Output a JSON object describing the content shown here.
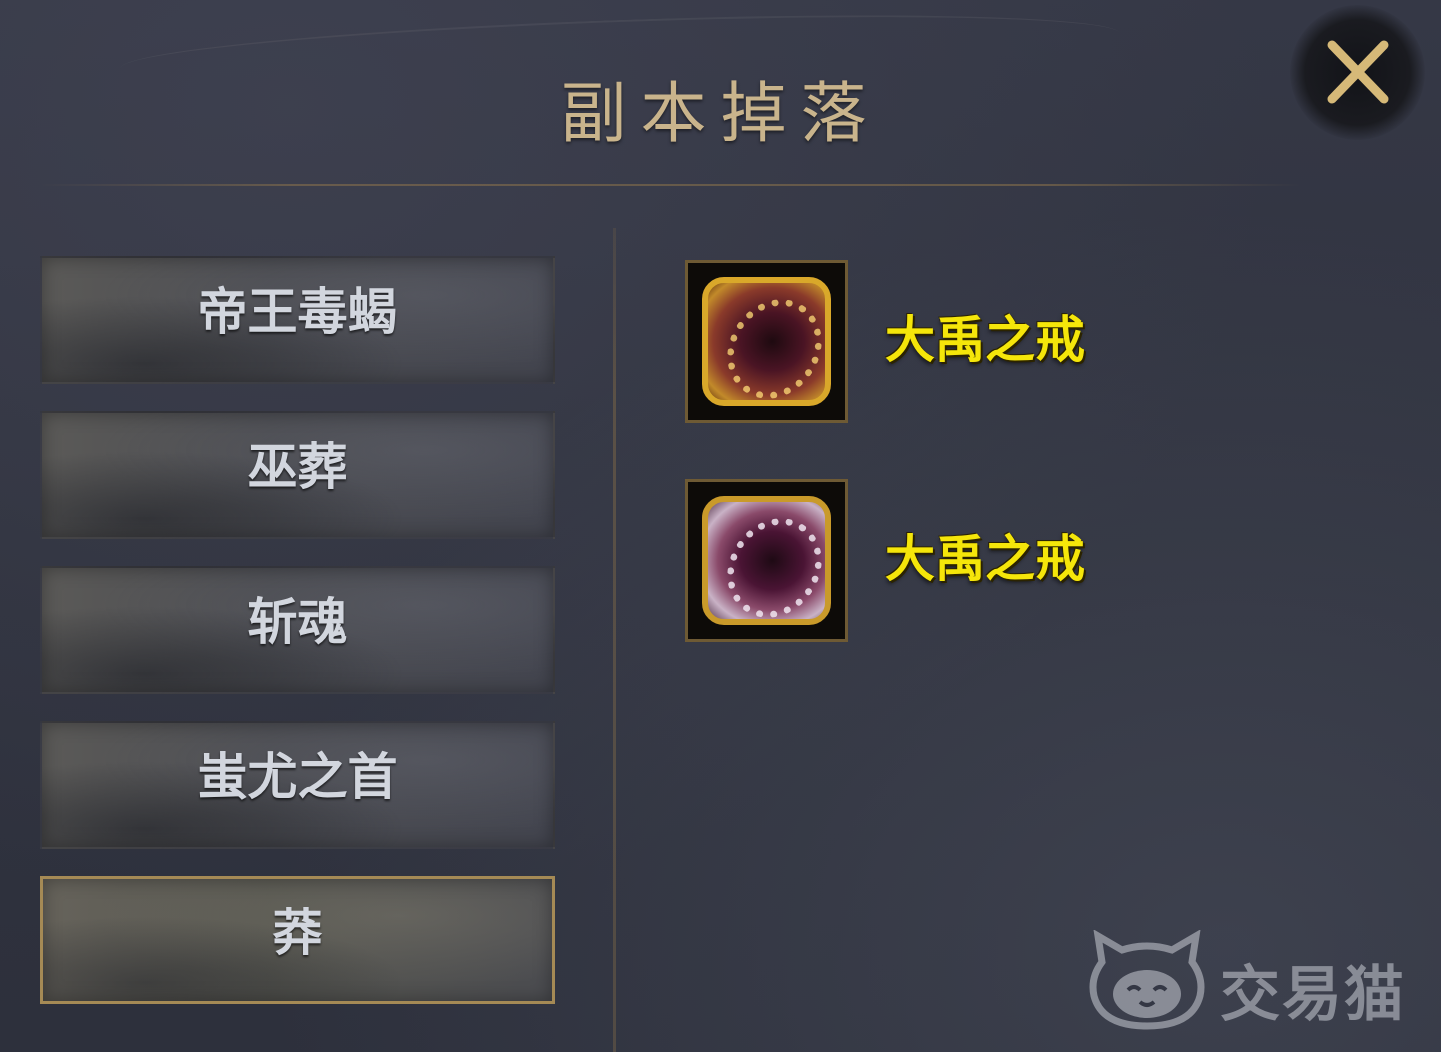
{
  "dialog": {
    "title": "副本掉落",
    "close_icon": "close-icon",
    "accent_color": "#c9b48c"
  },
  "dungeons": [
    {
      "label": "帝王毒蝎",
      "selected": false
    },
    {
      "label": "巫葬",
      "selected": false
    },
    {
      "label": "斩魂",
      "selected": false
    },
    {
      "label": "蚩尤之首",
      "selected": false
    },
    {
      "label": "莽",
      "selected": true
    }
  ],
  "drops": [
    {
      "name": "大禹之戒",
      "icon": "gold-ring-icon",
      "name_color": "#f5e60a"
    },
    {
      "name": "大禹之戒",
      "icon": "silver-ring-icon",
      "name_color": "#f5e60a"
    }
  ],
  "watermark": {
    "text": "交易猫",
    "icon": "cat-logo-icon"
  }
}
